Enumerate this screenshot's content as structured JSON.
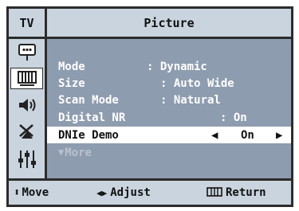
{
  "header": {
    "tv_label": "TV",
    "title": "Picture"
  },
  "sidebar": {
    "items": [
      {
        "icon": "input-icon"
      },
      {
        "icon": "picture-icon",
        "active": true
      },
      {
        "icon": "sound-icon"
      },
      {
        "icon": "channel-icon"
      },
      {
        "icon": "setup-icon"
      }
    ]
  },
  "menu": {
    "rows": [
      {
        "label": "Mode",
        "value": ": Dynamic"
      },
      {
        "label": "Size",
        "value": ": Auto Wide"
      },
      {
        "label": "Scan Mode",
        "value": ": Natural"
      },
      {
        "label": "Digital NR",
        "value": ": On"
      },
      {
        "label": "DNIe Demo",
        "value": "On",
        "selected": true
      },
      {
        "label": "More"
      }
    ],
    "left_arrow": "◀",
    "right_arrow": "▶",
    "more_arrow": "▼"
  },
  "footer": {
    "move_icon": "⬍",
    "move_label": "Move",
    "adjust_icon": "◀▶",
    "adjust_label": "Adjust",
    "return_label": "Return"
  },
  "colors": {
    "panel": "#8e9caf",
    "header": "#c9d4de",
    "highlight": "#ffffff",
    "border": "#2c2c2c"
  }
}
